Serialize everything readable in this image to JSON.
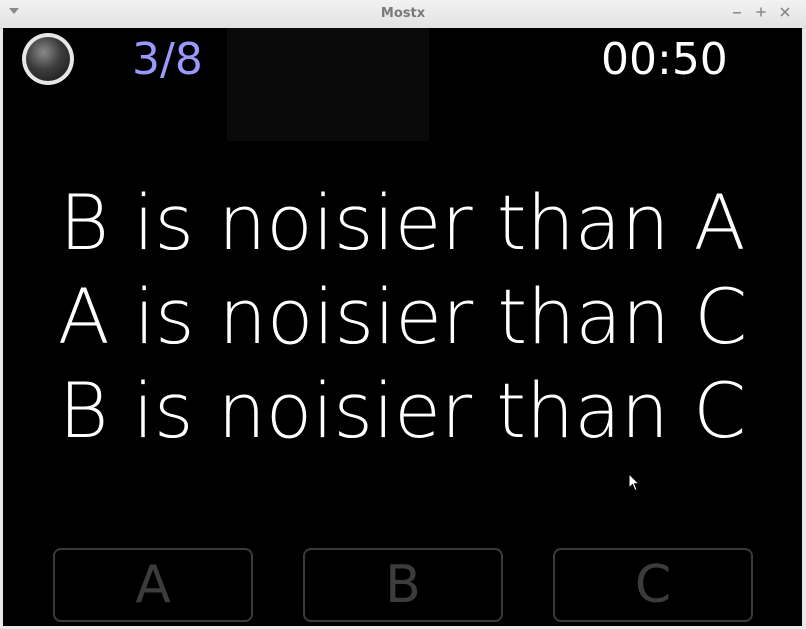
{
  "window": {
    "title": "Mostx",
    "menu_icon": "chevron-down-icon",
    "minimize_icon": "minimize-icon",
    "maximize_icon": "maximize-icon",
    "close_icon": "close-icon"
  },
  "header": {
    "progress": "3/8",
    "timer": "00:50",
    "progress_color": "#9b98ff"
  },
  "statements": [
    "B is noisier than A",
    "A is noisier than C",
    "B is noisier than C"
  ],
  "answers": [
    "A",
    "B",
    "C"
  ]
}
